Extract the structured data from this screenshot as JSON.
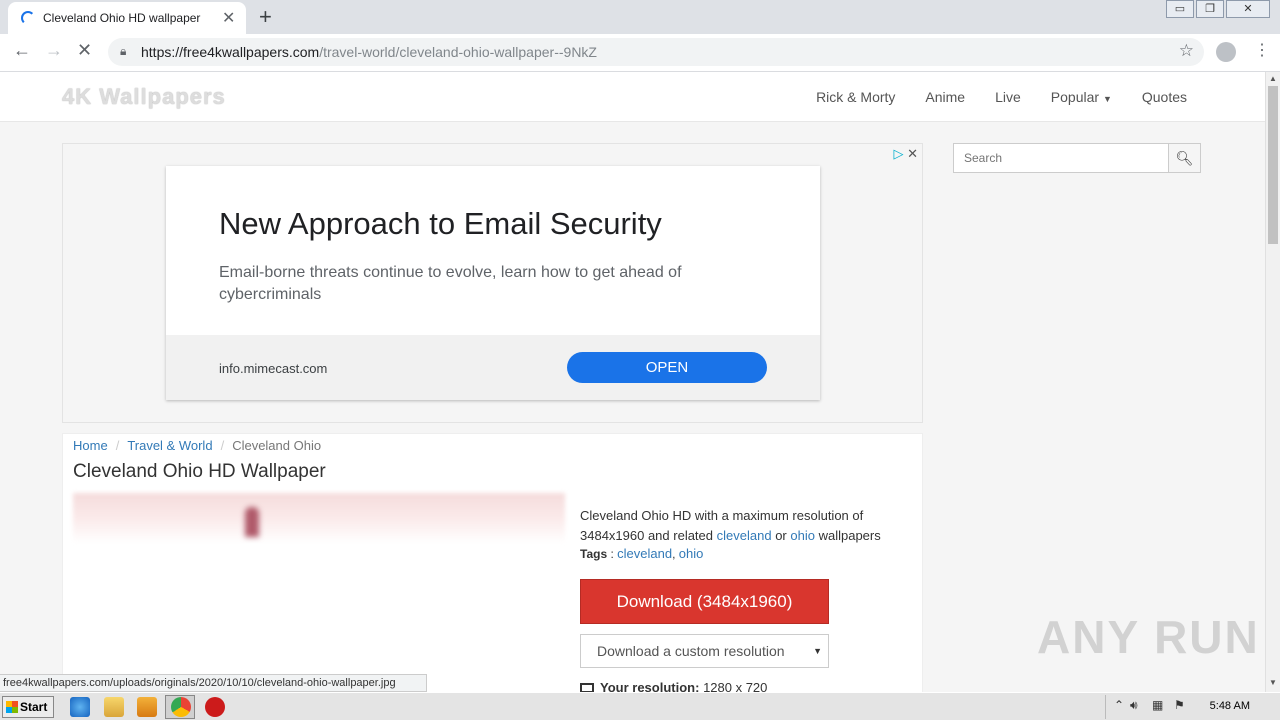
{
  "browser": {
    "tab_title": "Cleveland Ohio HD wallpaper",
    "tab_close": "✕",
    "new_tab": "+",
    "url_host": "https://free4kwallpapers.com",
    "url_path": "/travel-world/cleveland-ohio-wallpaper--9NkZ",
    "back": "←",
    "forward": "→",
    "stop": "✕",
    "window_min": "▭",
    "window_restore": "❐",
    "window_close": "✕",
    "status_url": "free4kwallpapers.com/uploads/originals/2020/10/10/cleveland-ohio-wallpaper.jpg"
  },
  "site": {
    "logo": "4K Wallpapers",
    "nav": [
      "Rick & Morty",
      "Anime",
      "Live",
      "Popular",
      "Quotes"
    ],
    "search_placeholder": "Search"
  },
  "ad": {
    "title": "New Approach to Email Security",
    "description": "Email-borne threats continue to evolve, learn how to get ahead of cybercriminals",
    "domain": "info.mimecast.com",
    "button": "OPEN"
  },
  "page": {
    "breadcrumb": [
      "Home",
      "Travel & World",
      "Cleveland Ohio"
    ],
    "title": "Cleveland Ohio HD Wallpaper",
    "desc_prefix": "Cleveland Ohio HD with a maximum resolution of 3484x1960 and related",
    "desc_link1": "cleveland",
    "desc_or": "or",
    "desc_link2": "ohio",
    "desc_suffix": "wallpapers",
    "tags_label": "Tags",
    "tags": [
      "cleveland",
      "ohio"
    ],
    "download_button": "Download (3484x1960)",
    "custom_resolution": "Download a custom resolution",
    "your_res_label": "Your resolution:",
    "your_res_value": "1280 x 720"
  },
  "taskbar": {
    "start": "Start",
    "clock": "5:48 AM"
  },
  "watermark": "ANY RUN"
}
